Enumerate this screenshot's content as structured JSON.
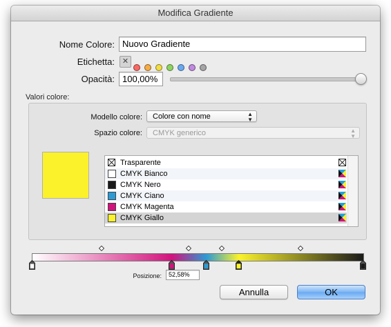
{
  "window": {
    "title": "Modifica Gradiente"
  },
  "form": {
    "name_label": "Nome Colore:",
    "name_value": "Nuovo Gradiente",
    "tag_label": "Etichetta:",
    "tag_colors": [
      "#fb6862",
      "#f7ab42",
      "#f2dd42",
      "#8cd460",
      "#6aa9f2",
      "#c08ae0",
      "#a5a5a5"
    ],
    "opacity_label": "Opacità:",
    "opacity_value": "100,00%",
    "opacity_level": 1.0
  },
  "color_values": {
    "group_label": "Valori colore:",
    "model_label": "Modello colore:",
    "model_value": "Colore con nome",
    "space_label": "Spazio colore:",
    "space_value": "CMYK generico",
    "preview_color": "#fbf22c"
  },
  "swatches": [
    {
      "name": "Trasparente",
      "color": "transparent",
      "kind": "transparent"
    },
    {
      "name": "CMYK Bianco",
      "color": "#ffffff",
      "kind": "cmyk"
    },
    {
      "name": "CMYK Nero",
      "color": "#1a1a1a",
      "kind": "cmyk"
    },
    {
      "name": "CMYK Ciano",
      "color": "#2e9ad3",
      "kind": "cmyk"
    },
    {
      "name": "CMYK Magenta",
      "color": "#d1137c",
      "kind": "cmyk"
    },
    {
      "name": "CMYK Giallo",
      "color": "#fbf22c",
      "kind": "cmyk",
      "selected": true
    }
  ],
  "gradient": {
    "stops": [
      {
        "position": 0.0,
        "color": "#ffffff",
        "selected": false
      },
      {
        "position": 0.4211,
        "color": "#d1137c",
        "selected": false
      },
      {
        "position": 0.5258,
        "color": "#2e9ad3",
        "selected": false
      },
      {
        "position": 0.6244,
        "color": "#fbf22c",
        "selected": true
      },
      {
        "position": 1.0,
        "color": "#1a1a1a",
        "selected": false
      }
    ],
    "midpoints": [
      0.2105,
      0.4737,
      0.5751,
      0.8122
    ],
    "position_label": "Posizione:",
    "position_value": "52,58%"
  },
  "buttons": {
    "cancel": "Annulla",
    "ok": "OK"
  }
}
